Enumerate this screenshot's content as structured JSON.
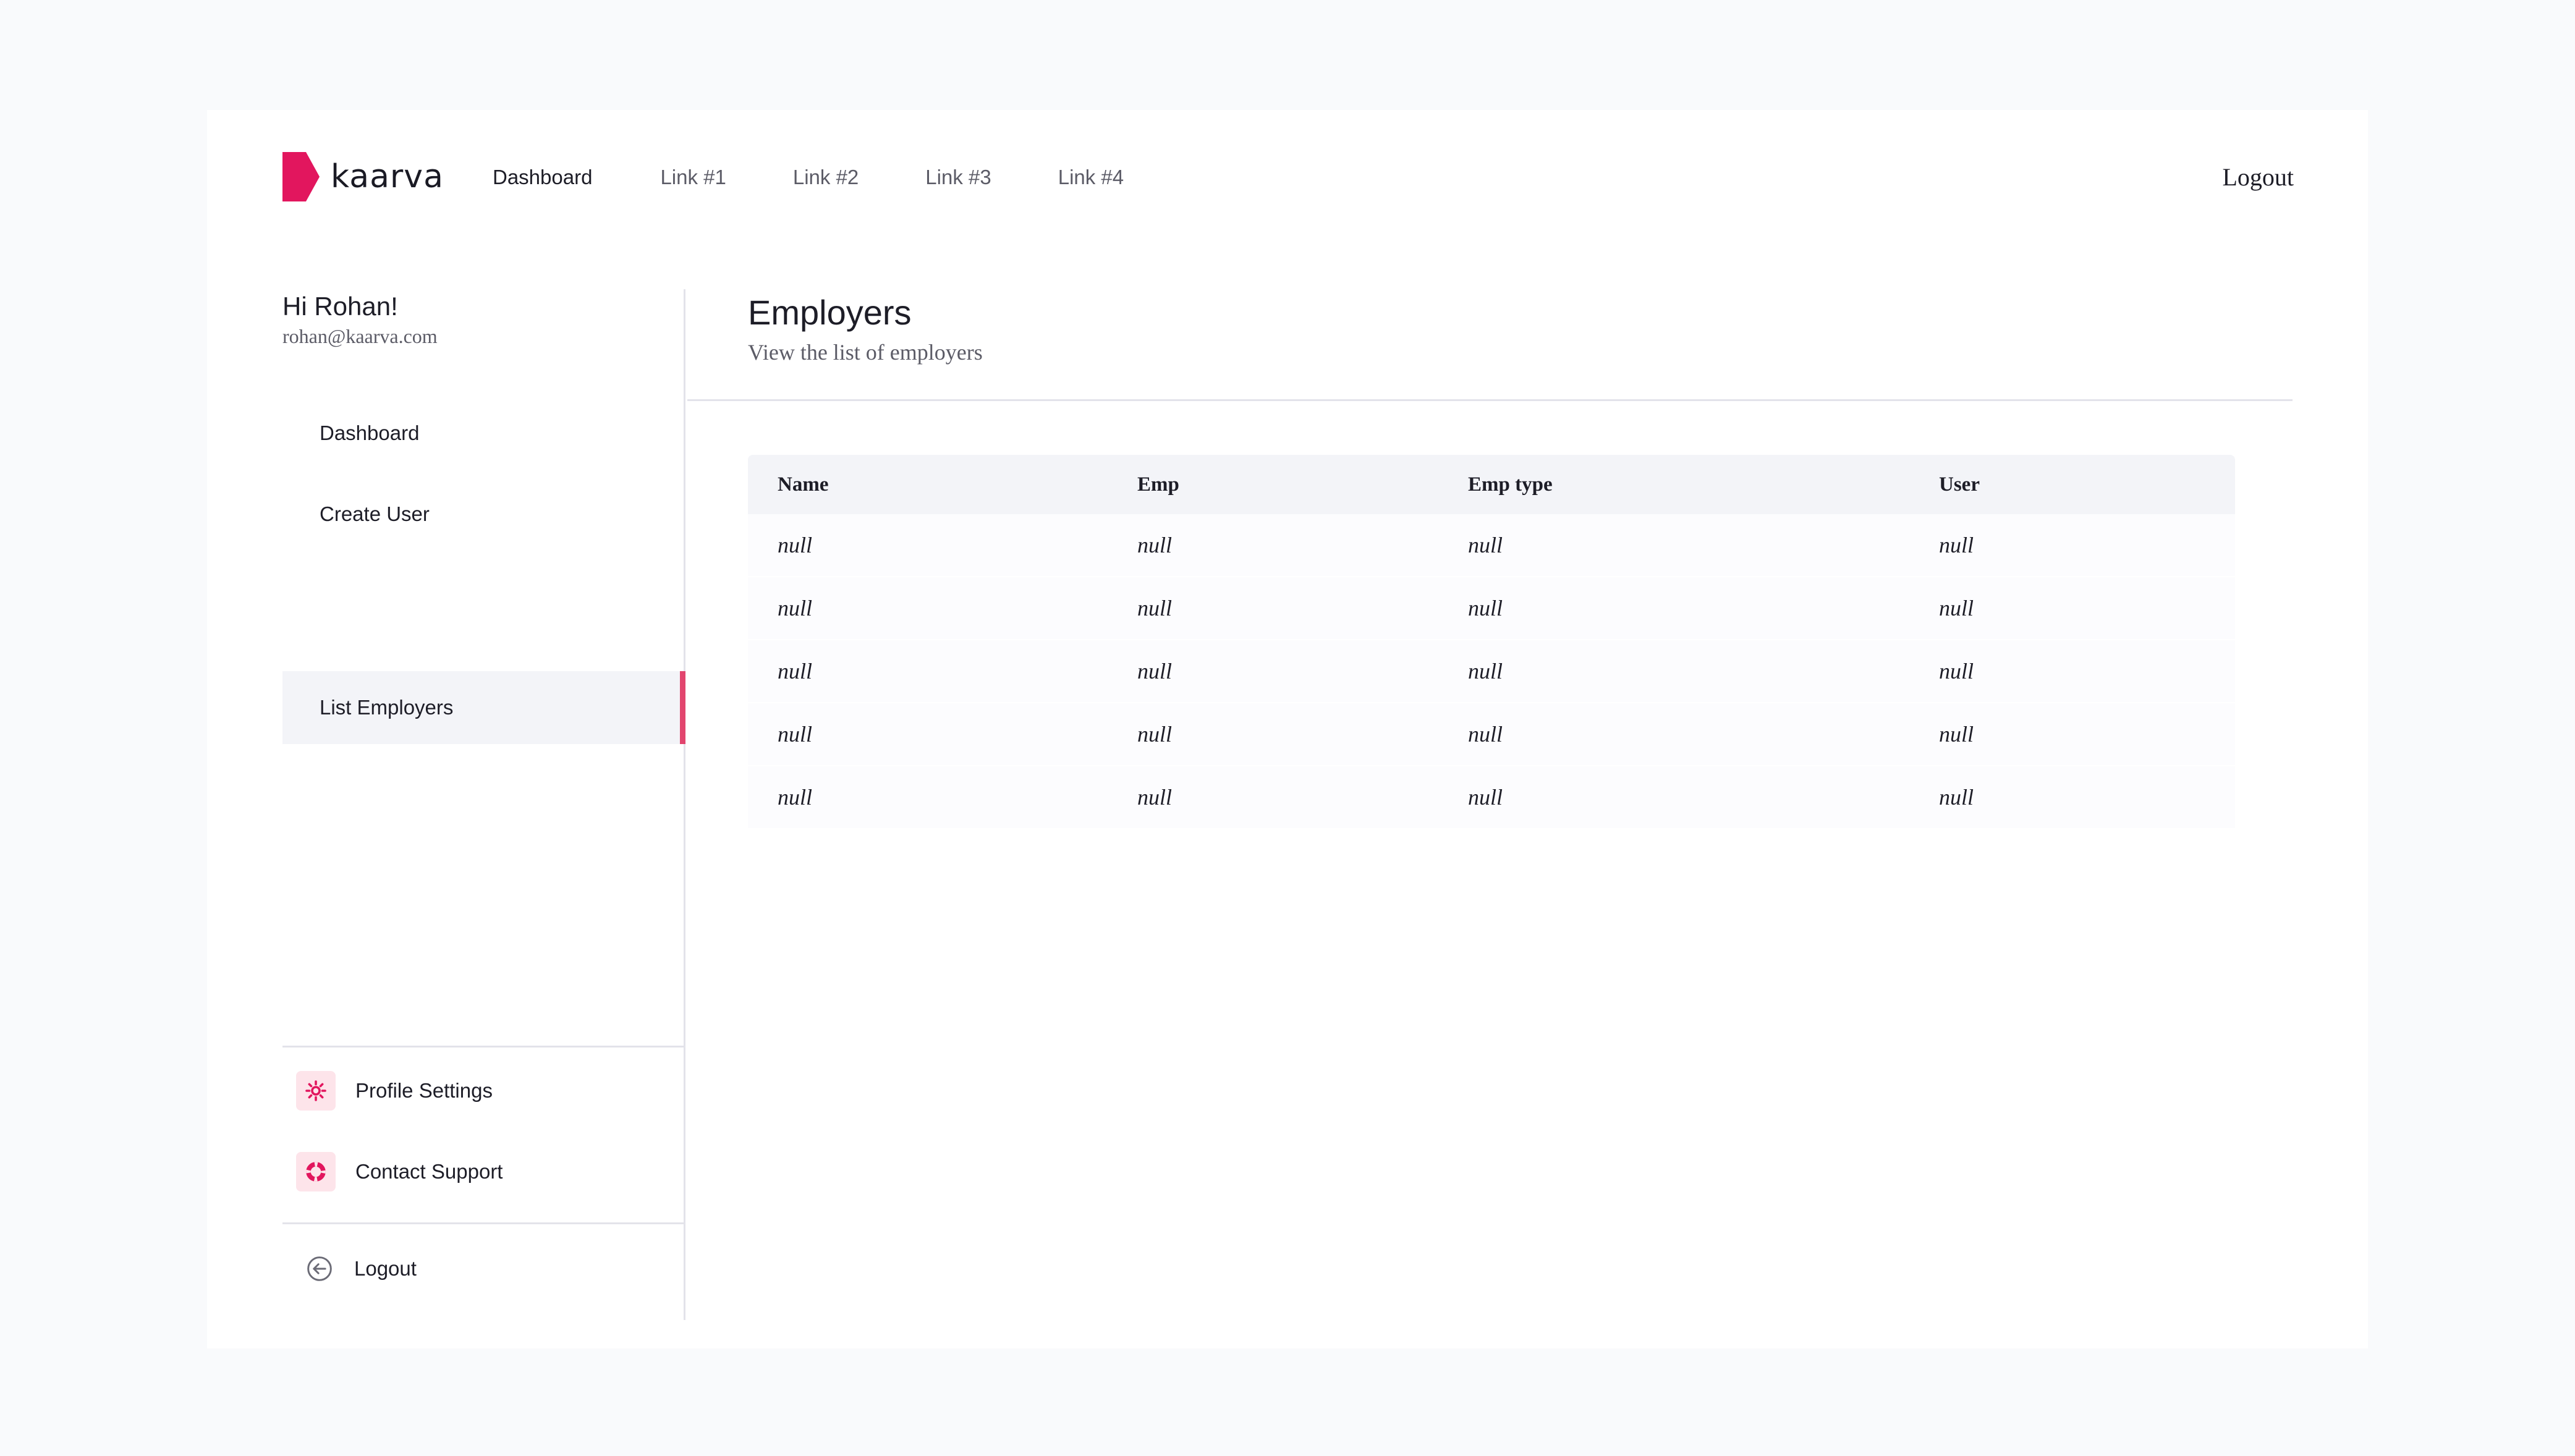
{
  "brand": {
    "name": "kaarva",
    "accent_color": "#e2165e",
    "mark_icon": "k-logo-mark"
  },
  "topnav": {
    "links": [
      "Dashboard",
      "Link #1",
      "Link #2",
      "Link #3",
      "Link #4"
    ],
    "active_link": "Dashboard",
    "logout_label": "Logout"
  },
  "user": {
    "greeting": "Hi Rohan!",
    "email": "rohan@kaarva.com"
  },
  "sidebar": {
    "items": [
      {
        "label": "Dashboard",
        "active": false
      },
      {
        "label": "Create User",
        "active": false
      },
      {
        "label": "List Employers",
        "active": true
      }
    ],
    "utilities": [
      {
        "label": "Profile Settings",
        "icon": "gear-icon"
      },
      {
        "label": "Contact Support",
        "icon": "lifebuoy-icon"
      }
    ],
    "logout_label": "Logout",
    "logout_icon": "arrow-left-circle-icon"
  },
  "main": {
    "title": "Employers",
    "subtitle": "View the list of employers",
    "table": {
      "columns": [
        "Name",
        "Emp",
        "Emp type",
        "User"
      ],
      "rows": [
        [
          "null",
          "null",
          "null",
          "null"
        ],
        [
          "null",
          "null",
          "null",
          "null"
        ],
        [
          "null",
          "null",
          "null",
          "null"
        ],
        [
          "null",
          "null",
          "null",
          "null"
        ],
        [
          "null",
          "null",
          "null",
          "null"
        ]
      ]
    }
  }
}
